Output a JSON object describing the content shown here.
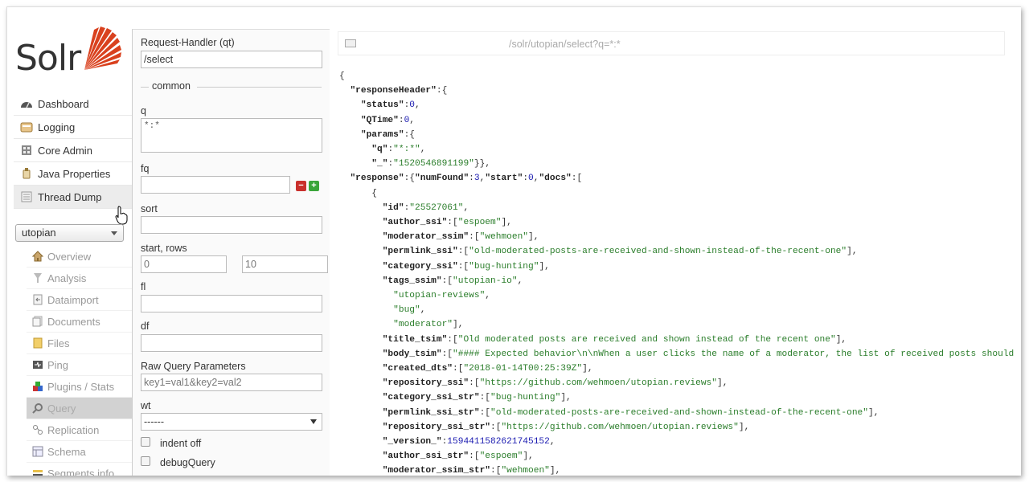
{
  "app": {
    "logo_text": "Solr",
    "brand_color": "#d9411e"
  },
  "nav": {
    "items": [
      {
        "label": "Dashboard",
        "icon": "dashboard-icon"
      },
      {
        "label": "Logging",
        "icon": "logging-icon"
      },
      {
        "label": "Core Admin",
        "icon": "core-admin-icon"
      },
      {
        "label": "Java Properties",
        "icon": "java-properties-icon"
      },
      {
        "label": "Thread Dump",
        "icon": "thread-dump-icon"
      }
    ]
  },
  "core_selector": {
    "selected": "utopian"
  },
  "core_menu": {
    "items": [
      {
        "label": "Overview",
        "icon": "overview-icon"
      },
      {
        "label": "Analysis",
        "icon": "analysis-icon"
      },
      {
        "label": "Dataimport",
        "icon": "dataimport-icon"
      },
      {
        "label": "Documents",
        "icon": "documents-icon"
      },
      {
        "label": "Files",
        "icon": "files-icon"
      },
      {
        "label": "Ping",
        "icon": "ping-icon"
      },
      {
        "label": "Plugins / Stats",
        "icon": "plugins-icon"
      },
      {
        "label": "Query",
        "icon": "query-icon",
        "active": true
      },
      {
        "label": "Replication",
        "icon": "replication-icon"
      },
      {
        "label": "Schema",
        "icon": "schema-icon"
      },
      {
        "label": "Segments info",
        "icon": "segments-icon"
      }
    ]
  },
  "form": {
    "request_handler_label": "Request-Handler (qt)",
    "request_handler_value": "/select",
    "common_legend": "common",
    "q_label": "q",
    "q_value": "*:*",
    "fq_label": "fq",
    "fq_value": "",
    "sort_label": "sort",
    "sort_value": "",
    "start_rows_label": "start, rows",
    "start_value": "0",
    "rows_value": "10",
    "fl_label": "fl",
    "fl_value": "",
    "df_label": "df",
    "df_value": "",
    "raw_label": "Raw Query Parameters",
    "raw_placeholder": "key1=val1&key2=val2",
    "wt_label": "wt",
    "wt_value": "------",
    "indent_label": "indent off",
    "debug_label": "debugQuery",
    "remove_symbol": "−",
    "add_symbol": "+"
  },
  "results": {
    "url": "/solr/utopian/select?q=*:*",
    "json": {
      "responseHeader": {
        "status": 0,
        "QTime": 0,
        "params": {
          "q": "*:*",
          "_": "1520546891199"
        }
      },
      "response": {
        "numFound": 3,
        "start": 0,
        "doc": {
          "id": "25527061",
          "author_ssi": "espoem",
          "moderator_ssim": "wehmoen",
          "permlink_ssi": "old-moderated-posts-are-received-and-shown-instead-of-the-recent-one",
          "category_ssi": "bug-hunting",
          "tags_ssim": [
            "utopian-io",
            "utopian-reviews",
            "bug",
            "moderator"
          ],
          "title_tsim": "Old moderated posts are received and shown instead of the recent one",
          "body_tsim": "#### Expected behavior\\n\\nWhen a user clicks the name of a moderator, the list of received posts should be fi",
          "created_dts": "2018-01-14T00:25:39Z",
          "repository_ssi": "https://github.com/wehmoen/utopian.reviews",
          "category_ssi_str": "bug-hunting",
          "permlink_ssi_str": "old-moderated-posts-are-received-and-shown-instead-of-the-recent-one",
          "repository_ssi_str": "https://github.com/wehmoen/utopian.reviews",
          "_version_": "1594411582621745152",
          "author_ssi_str": "espoem",
          "moderator_ssim_str": "wehmoen"
        }
      }
    }
  }
}
